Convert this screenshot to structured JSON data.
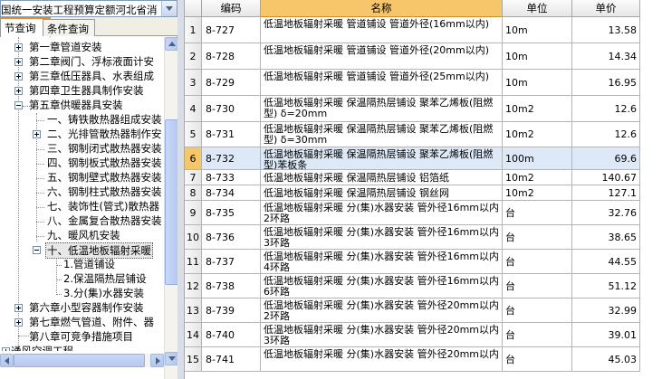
{
  "combo": {
    "value": "国统一安装工程预算定额河北省消"
  },
  "tabs": [
    {
      "label": "节查询",
      "active": true
    },
    {
      "label": "条件查询",
      "active": false
    }
  ],
  "tree": [
    {
      "label": "第一章管道安装"
    },
    {
      "label": "第二章阀门、浮标液面计安"
    },
    {
      "label": "第三章低压器具、水表组成"
    },
    {
      "label": "第四章卫生器具制作安装"
    },
    {
      "label": "第五章供暖器具安装"
    },
    {
      "label": "一、铸铁散热器组成安装"
    },
    {
      "label": "二、光排管散热器制作安"
    },
    {
      "label": "三、钢制闭式散热器安装"
    },
    {
      "label": "四、钢制板式散热器安装"
    },
    {
      "label": "五、钢制壁式散热器安装"
    },
    {
      "label": "六、钢制柱式散热器安装"
    },
    {
      "label": "七、装饰性(管式)散热器"
    },
    {
      "label": "八、金属复合散热器安装"
    },
    {
      "label": "九、暖风机安装"
    },
    {
      "label": "十、低温地板辐射采暖"
    },
    {
      "label": "1.管道铺设"
    },
    {
      "label": "2.保温隔热层铺设"
    },
    {
      "label": "3.分(集)水器安装"
    },
    {
      "label": "第六章小型容器制作安装"
    },
    {
      "label": "第七章燃气管道、附件、器"
    },
    {
      "label": "第八章可竞争措施项目"
    },
    {
      "label": "通风空调工程"
    }
  ],
  "grid": {
    "columns": [
      "",
      "编码",
      "名称",
      "单位",
      "单价"
    ],
    "rows": [
      {
        "n": "1",
        "code": "8-727",
        "name": "低温地板辐射采暖 管道铺设 管道外径(16mm以内)",
        "unit": "10m",
        "price": "13.58"
      },
      {
        "n": "2",
        "code": "8-728",
        "name": "低温地板辐射采暖 管道铺设 管道外径(20mm以内)",
        "unit": "10m",
        "price": "14.34"
      },
      {
        "n": "3",
        "code": "8-729",
        "name": "低温地板辐射采暖 管道铺设 管道外径(25mm以内)",
        "unit": "10m",
        "price": "16.95"
      },
      {
        "n": "4",
        "code": "8-730",
        "name": "低温地板辐射采暖 保温隔热层铺设 聚苯乙烯板(阻燃型) δ=20mm",
        "unit": "10m2",
        "price": "12.6"
      },
      {
        "n": "5",
        "code": "8-731",
        "name": "低温地板辐射采暖 保温隔热层铺设 聚苯乙烯板(阻燃型) δ=30mm",
        "unit": "10m2",
        "price": "12.6"
      },
      {
        "n": "6",
        "code": "8-732",
        "name": "低温地板辐射采暖 保温隔热层铺设 聚苯乙烯板(阻燃型)苯板条",
        "unit": "100m",
        "price": "69.6"
      },
      {
        "n": "7",
        "code": "8-733",
        "name": "低温地板辐射采暖 保温隔热层铺设 铝箔纸",
        "unit": "10m2",
        "price": "140.67"
      },
      {
        "n": "8",
        "code": "8-734",
        "name": "低温地板辐射采暖 保温隔热层铺设 钢丝网",
        "unit": "10m2",
        "price": "127.1"
      },
      {
        "n": "9",
        "code": "8-735",
        "name": "低温地板辐射采暖 分(集)水器安装 管外径16mm以内 2环路",
        "unit": "台",
        "price": "32.76"
      },
      {
        "n": "10",
        "code": "8-736",
        "name": "低温地板辐射采暖 分(集)水器安装 管外径16mm以内 3环路",
        "unit": "台",
        "price": "38.65"
      },
      {
        "n": "11",
        "code": "8-737",
        "name": "低温地板辐射采暖 分(集)水器安装 管外径16mm以内 4环路",
        "unit": "台",
        "price": "44.55"
      },
      {
        "n": "12",
        "code": "8-738",
        "name": "低温地板辐射采暖 分(集)水器安装 管外径16mm以内 6环路",
        "unit": "台",
        "price": "51.12"
      },
      {
        "n": "13",
        "code": "8-739",
        "name": "低温地板辐射采暖 分(集)水器安装 管外径20mm以内 2环路",
        "unit": "台",
        "price": "32.99"
      },
      {
        "n": "14",
        "code": "8-740",
        "name": "低温地板辐射采暖 分(集)水器安装 管外径20mm以内 3环路",
        "unit": "台",
        "price": "39.01"
      },
      {
        "n": "15",
        "code": "8-741",
        "name": "低温地板辐射采暖 分(集)水器安装 管外径20mm以内",
        "unit": "台",
        "price": "45.03"
      }
    ]
  }
}
